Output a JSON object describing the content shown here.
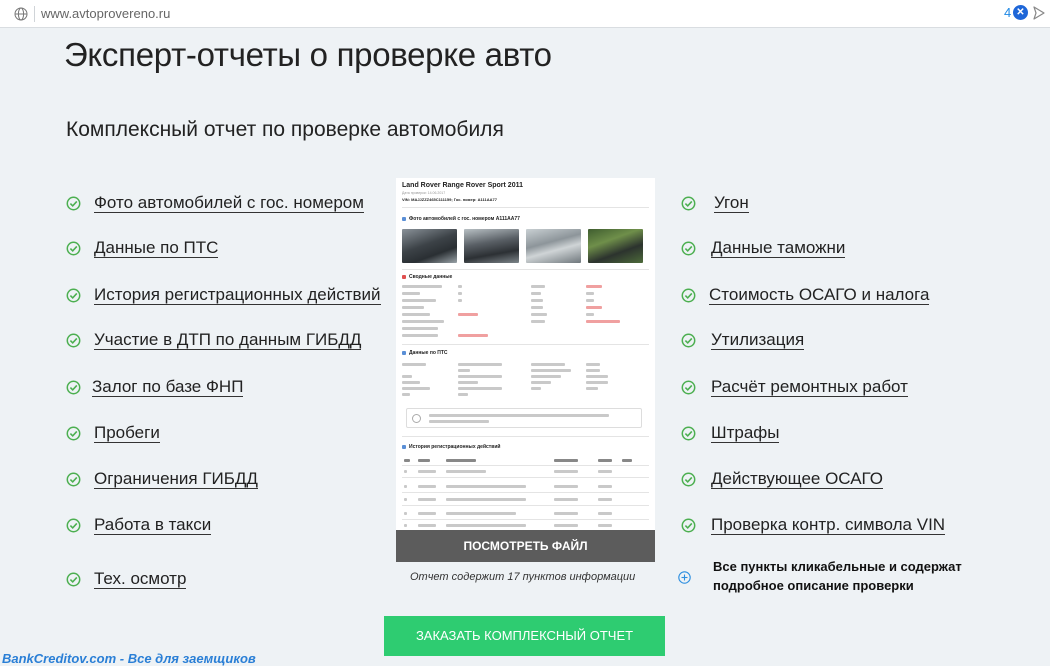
{
  "browser": {
    "url": "www.avtoprovereno.ru",
    "ext_count": "4",
    "ext_badge": "✕"
  },
  "page": {
    "title": "Эксперт-отчеты о проверке авто",
    "subtitle": "Комплексный отчет по проверке автомобиля"
  },
  "features_left": [
    "Фото автомобилей с гос. номером",
    "Данные по ПТС",
    "История регистрационных действий",
    "Участие в ДТП по данным ГИБДД",
    "Залог по базе ФНП",
    "Пробеги",
    "Ограничения ГИБДД",
    "Работа в такси",
    "Тех. осмотр"
  ],
  "features_right": [
    "Угон",
    "Данные таможни",
    "Стоимость ОСАГО и налога",
    "Утилизация",
    "Расчёт ремонтных работ",
    "Штрафы",
    "Действующее ОСАГО",
    "Проверка контр. символа VIN"
  ],
  "preview": {
    "report_title": "Land Rover Range Rover Sport 2011",
    "meta": "Дата проверки: 14.06.2017",
    "vin_line": "VIN: MAJJZZZ465C111159; Гос. номер: А111АА77",
    "section_photos": "Фото автомобилей с гос. номером А111АА77",
    "section_summary": "Сводные данные",
    "section_pts": "Данные по ПТС",
    "section_history": "История регистрационных действий",
    "view_button": "ПОСМОТРЕТЬ ФАЙЛ"
  },
  "caption": "Отчет содержит 17 пунктов информации",
  "note": "Все пункты кликабельные и содержат подробное описание проверки",
  "order_button": "ЗАКАЗАТЬ КОМПЛЕКСНЫЙ ОТЧЕТ",
  "watermark": "BankCreditov.com - Все для заемщиков",
  "colors": {
    "accent_green": "#2ecc71",
    "check_green": "#4caf50",
    "link_blue": "#1e88e5"
  },
  "icons": {
    "check": "check-circle-icon",
    "plus": "plus-circle-icon",
    "globe": "globe-icon",
    "send": "send-icon"
  }
}
